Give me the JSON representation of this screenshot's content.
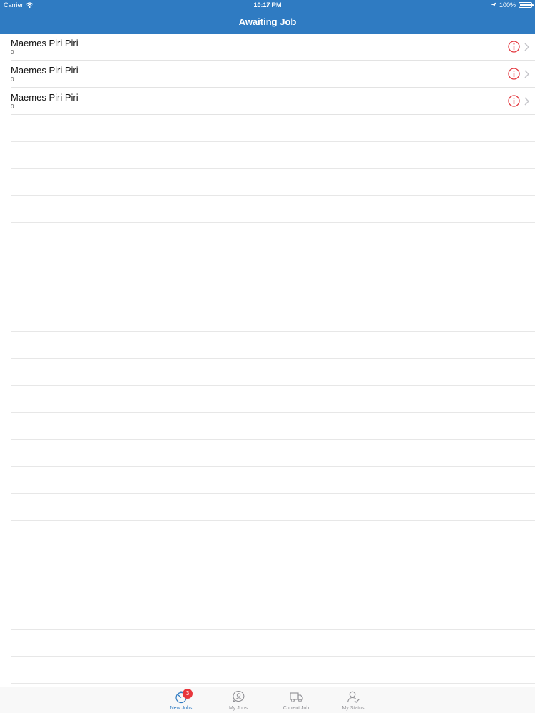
{
  "status_bar": {
    "carrier": "Carrier",
    "time": "10:17 PM",
    "battery": "100%"
  },
  "nav": {
    "title": "Awaiting Job"
  },
  "jobs": [
    {
      "title": "Maemes Piri Piri",
      "subtitle": "0"
    },
    {
      "title": "Maemes Piri Piri",
      "subtitle": "0"
    },
    {
      "title": "Maemes Piri Piri",
      "subtitle": "0"
    }
  ],
  "tabs": [
    {
      "label": "New Jobs",
      "icon": "stopwatch-icon",
      "badge": "3",
      "active": true
    },
    {
      "label": "My Jobs",
      "icon": "chat-person-icon",
      "active": false
    },
    {
      "label": "Current Job",
      "icon": "truck-icon",
      "active": false
    },
    {
      "label": "My Status",
      "icon": "person-check-icon",
      "active": false
    }
  ],
  "colors": {
    "accent": "#2f7bc2",
    "info": "#e3363d",
    "badge": "#e8363c"
  }
}
